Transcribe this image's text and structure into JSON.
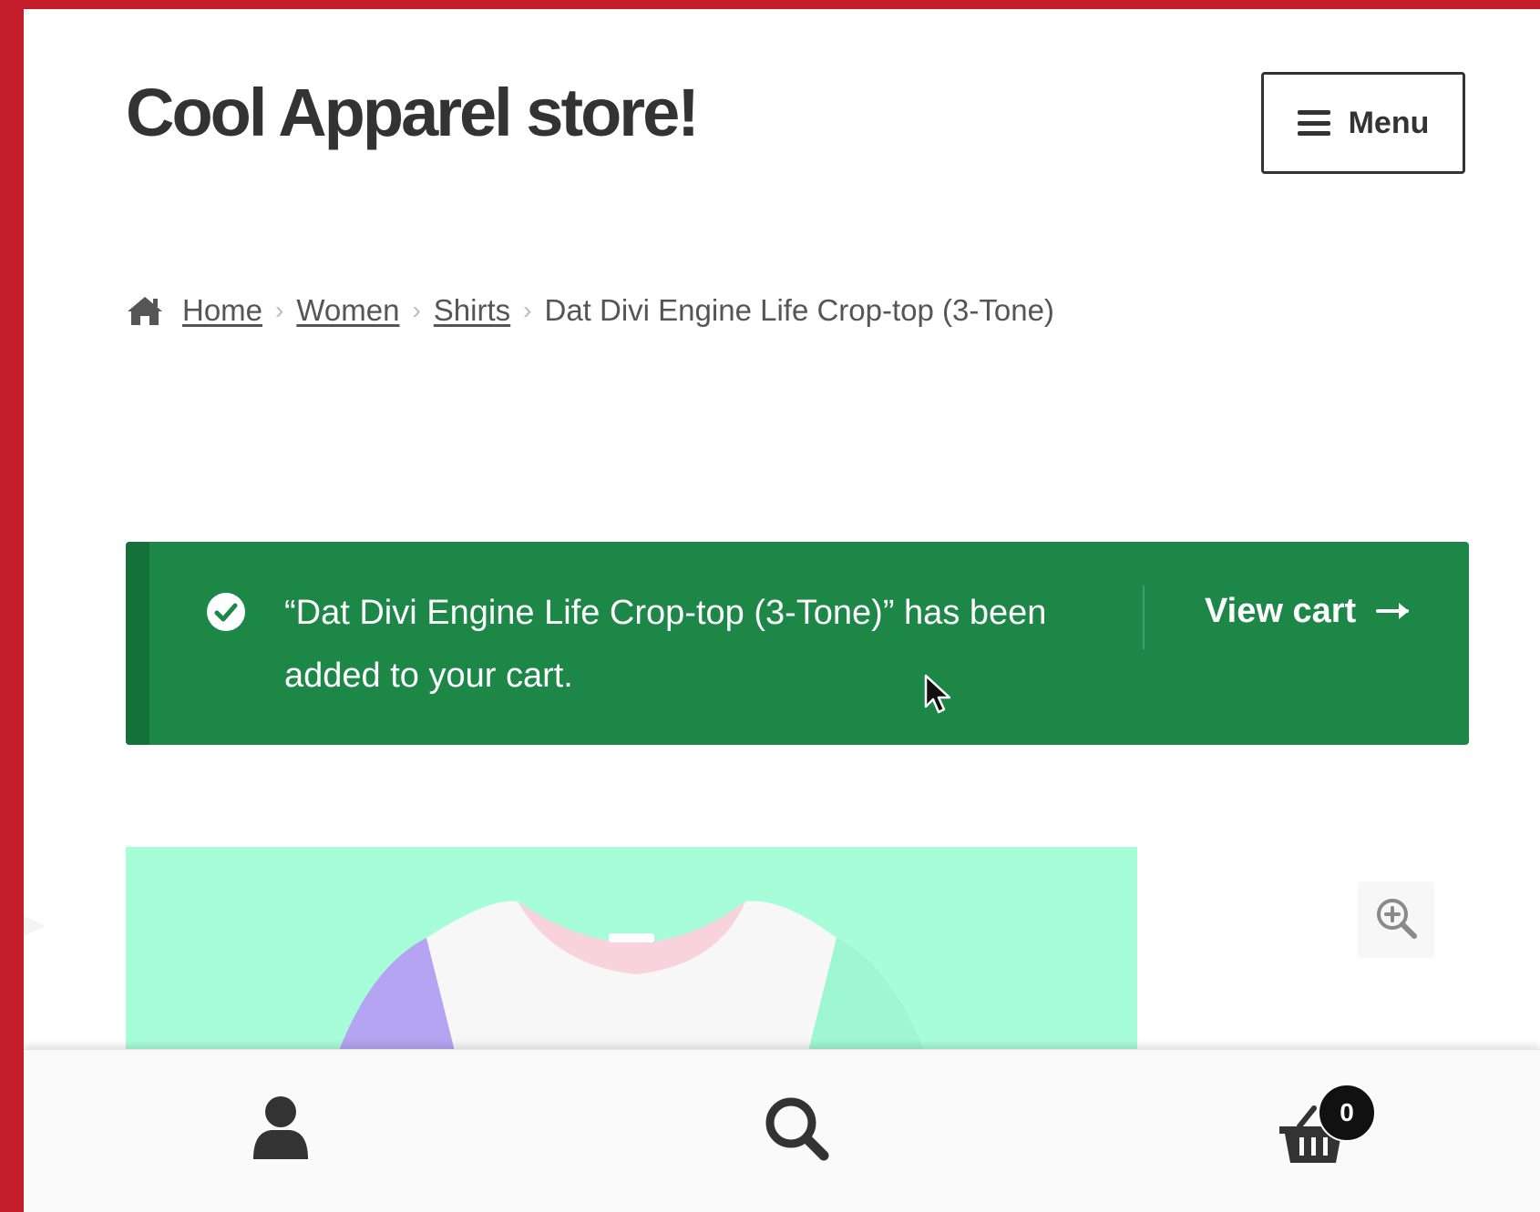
{
  "site": {
    "title": "Cool Apparel store!"
  },
  "header": {
    "menu_label": "Menu",
    "menu_icon": "hamburger-icon"
  },
  "breadcrumb": {
    "home_icon": "home-icon",
    "items": [
      "Home",
      "Women",
      "Shirts"
    ],
    "current": "Dat Divi Engine Life Crop-top (3-Tone)"
  },
  "notice": {
    "icon": "check-circle-icon",
    "message": "“Dat Divi Engine Life Crop-top (3-Tone)” has been added to your cart.",
    "action_label": "View cart",
    "action_icon": "arrow-right-icon",
    "color": "#1d8748"
  },
  "product": {
    "image_bg": "#a8fdd9",
    "zoom_icon": "zoom-in-icon"
  },
  "footer_nav": {
    "account_icon": "user-icon",
    "search_icon": "search-icon",
    "cart_icon": "basket-icon",
    "cart_count": "0"
  },
  "colors": {
    "frame_border": "#c41e2c",
    "text": "#333333"
  }
}
